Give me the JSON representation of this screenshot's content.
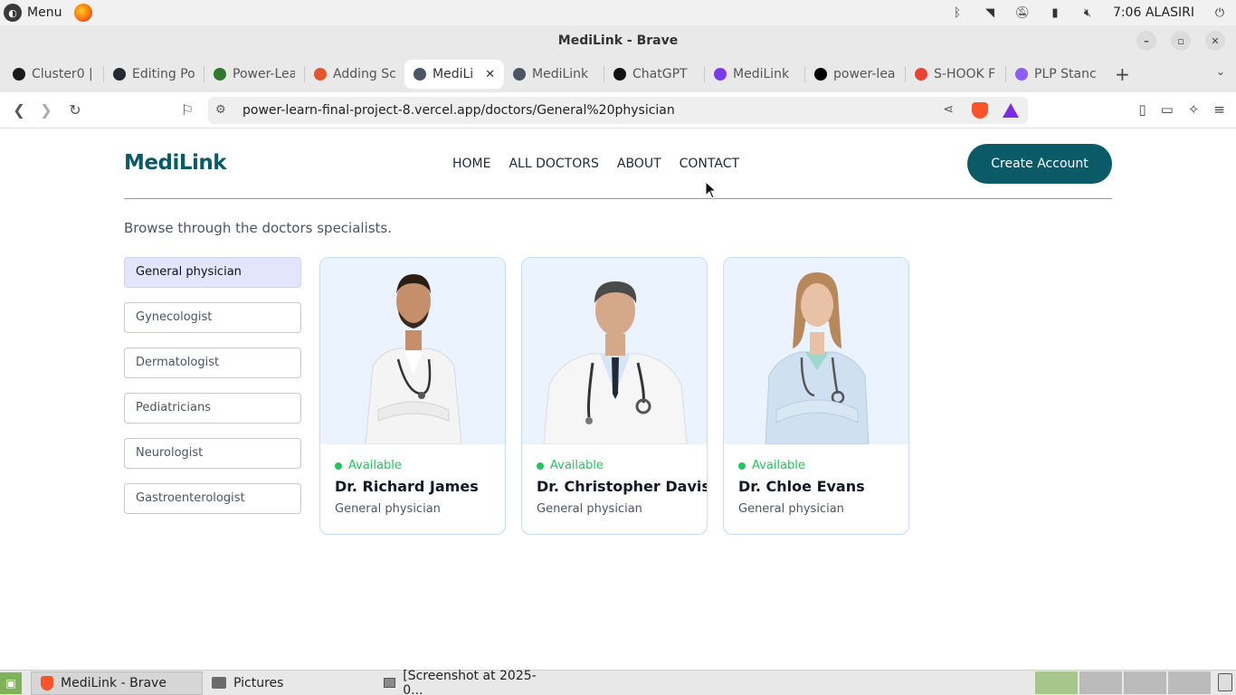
{
  "os_top": {
    "menu_label": "Menu",
    "clock": "7:06",
    "user": "ALASIRI"
  },
  "window": {
    "title": "MediLink - Brave"
  },
  "tabs": [
    {
      "label": "Cluster0 |",
      "fav_color": "#1a1a1a"
    },
    {
      "label": "Editing Po",
      "fav_color": "#24292f"
    },
    {
      "label": "Power-Lea",
      "fav_color": "#2f7a2f"
    },
    {
      "label": "Adding Sc",
      "fav_color": "#e4572e"
    },
    {
      "label": "MediLi",
      "fav_color": "#4b5563",
      "active": true
    },
    {
      "label": "MediLink",
      "fav_color": "#4b5563"
    },
    {
      "label": "ChatGPT",
      "fav_color": "#111111"
    },
    {
      "label": "MediLink",
      "fav_color": "#7c3aed"
    },
    {
      "label": "power-lea",
      "fav_color": "#000000"
    },
    {
      "label": "S-HOOK F",
      "fav_color": "#ea4335"
    },
    {
      "label": "PLP Stanc",
      "fav_color": "#8b5cf6"
    }
  ],
  "toolbar": {
    "url": "power-learn-final-project-8.vercel.app/doctors/General%20physician"
  },
  "site": {
    "logo": "MediLink",
    "nav": [
      "HOME",
      "ALL DOCTORS",
      "ABOUT",
      "CONTACT"
    ],
    "create_account": "Create Account",
    "browse_text": "Browse through the doctors specialists.",
    "specialities": [
      "General physician",
      "Gynecologist",
      "Dermatologist",
      "Pediatricians",
      "Neurologist",
      "Gastroenterologist"
    ],
    "active_speciality": "General physician",
    "doctors": [
      {
        "name": "Dr. Richard James",
        "speciality": "General physician",
        "status": "Available"
      },
      {
        "name": "Dr. Christopher Davis",
        "speciality": "General physician",
        "status": "Available"
      },
      {
        "name": "Dr. Chloe Evans",
        "speciality": "General physician",
        "status": "Available"
      }
    ],
    "colors": {
      "brand": "#0b5a68",
      "available": "#22c55e",
      "active_filter": "#e2e5fb",
      "card_border": "#c3dafa",
      "photo_bg": "#eaf3ff"
    }
  },
  "taskbar": {
    "items": [
      {
        "label": "MediLink - Brave",
        "active": true
      },
      {
        "label": "Pictures"
      },
      {
        "label": "[Screenshot at 2025-0..."
      }
    ]
  }
}
